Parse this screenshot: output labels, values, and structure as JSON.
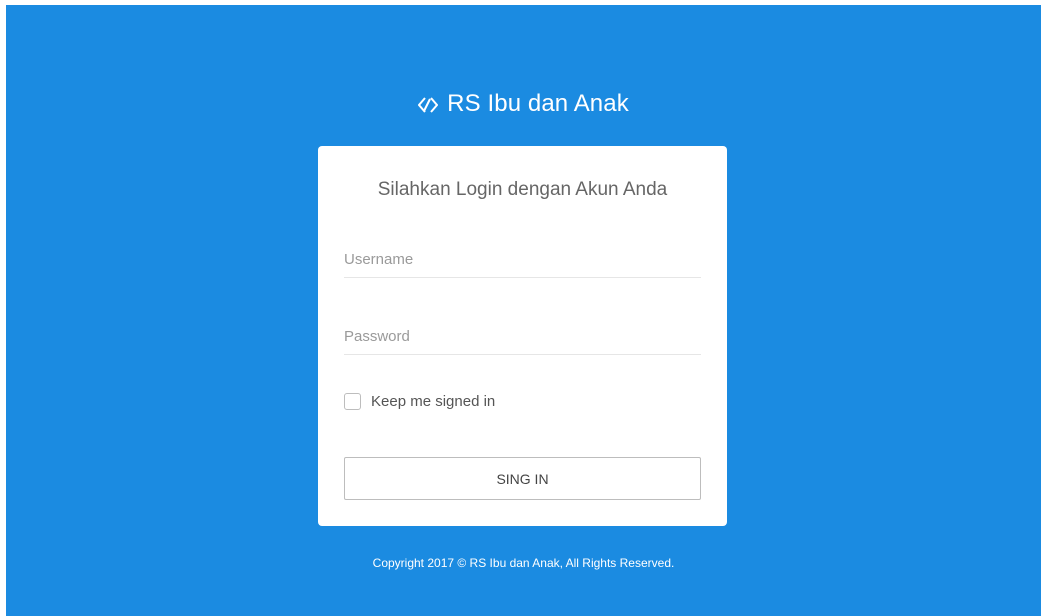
{
  "brand": {
    "title": "RS Ibu dan Anak",
    "icon": "diamond-chevrons-icon"
  },
  "login": {
    "heading": "Silahkan Login dengan Akun Anda",
    "username_placeholder": "Username",
    "username_value": "",
    "password_placeholder": "Password",
    "password_value": "",
    "remember_label": "Keep me signed in",
    "remember_checked": false,
    "submit_label": "SING IN"
  },
  "footer": {
    "copyright": "Copyright 2017 © RS Ibu dan Anak, All Rights Reserved."
  },
  "colors": {
    "background": "#1b8be1",
    "card": "#ffffff",
    "text": "#666666"
  }
}
